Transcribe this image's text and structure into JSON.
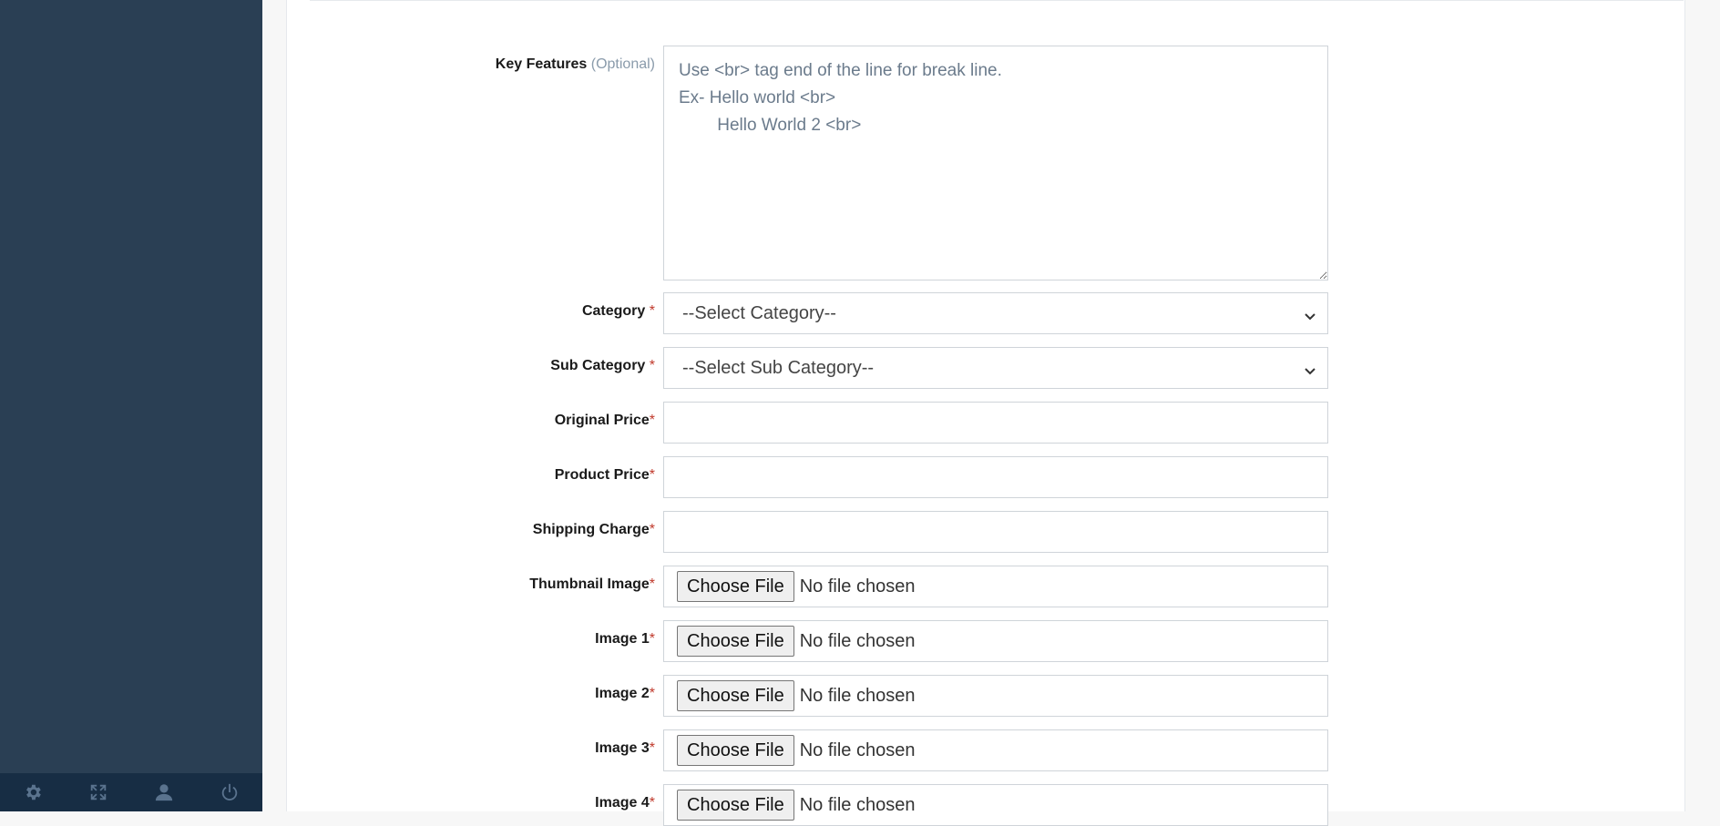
{
  "form": {
    "key_features": {
      "label": "Key Features",
      "optional": "(Optional)",
      "placeholder": "Use <br> tag end of the line for break line.\nEx- Hello world <br>\n        Hello World 2 <br>"
    },
    "category": {
      "label": "Category",
      "required": "*",
      "selected": "--Select Category--"
    },
    "sub_category": {
      "label": "Sub Category",
      "required": "*",
      "selected": "--Select Sub Category--"
    },
    "original_price": {
      "label": "Original Price",
      "required": "*",
      "value": ""
    },
    "product_price": {
      "label": "Product Price",
      "required": "*",
      "value": ""
    },
    "shipping_charge": {
      "label": "Shipping Charge",
      "required": "*",
      "value": ""
    },
    "files": [
      {
        "label": "Thumbnail Image",
        "required": "*",
        "button": "Choose File",
        "status": "No file chosen"
      },
      {
        "label": "Image 1",
        "required": "*",
        "button": "Choose File",
        "status": "No file chosen"
      },
      {
        "label": "Image 2",
        "required": "*",
        "button": "Choose File",
        "status": "No file chosen"
      },
      {
        "label": "Image 3",
        "required": "*",
        "button": "Choose File",
        "status": "No file chosen"
      },
      {
        "label": "Image 4",
        "required": "*",
        "button": "Choose File",
        "status": "No file chosen"
      }
    ]
  },
  "sidebar_footer": {
    "icons": [
      "gear-icon",
      "fullscreen-icon",
      "user-icon",
      "power-icon"
    ]
  }
}
